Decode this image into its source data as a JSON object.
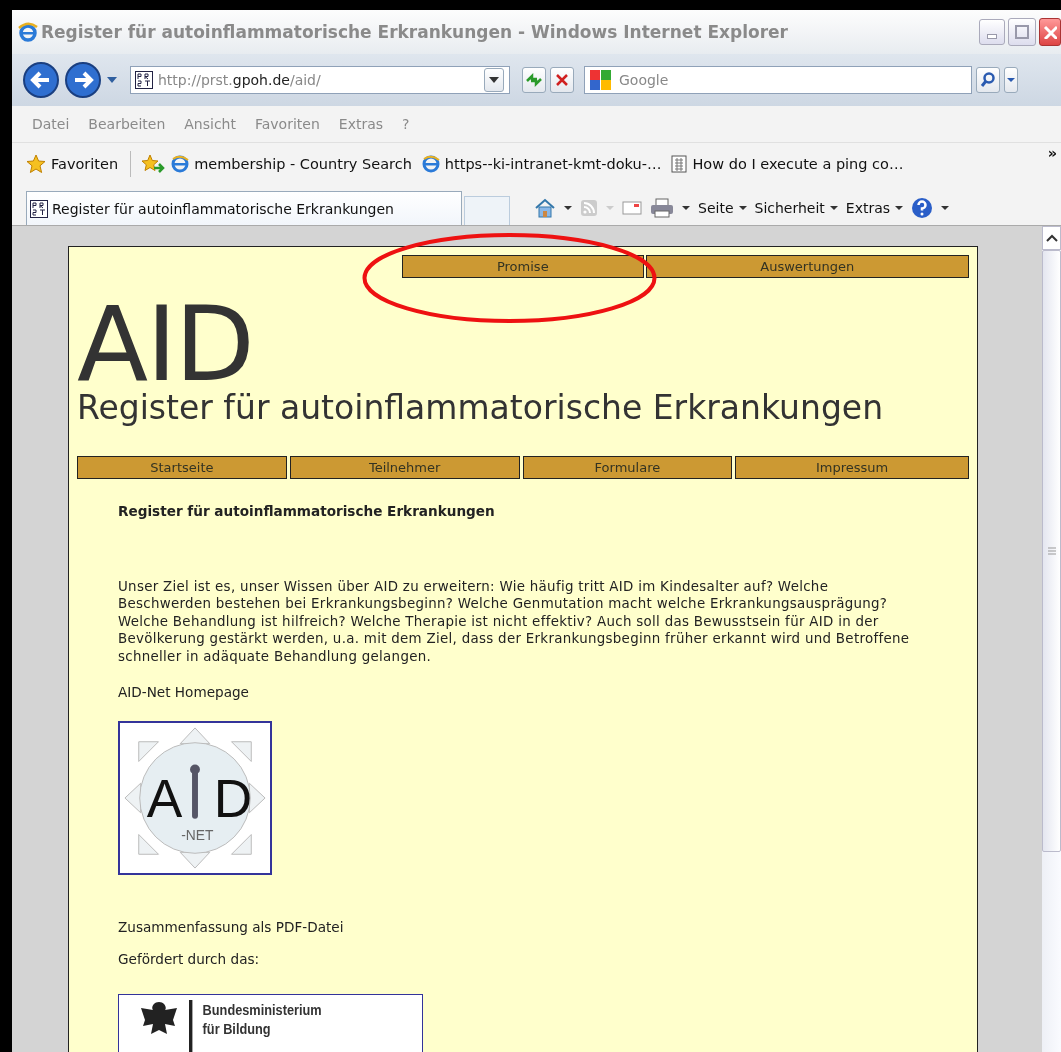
{
  "window": {
    "title": "Register für autoinflammatorische Erkrankungen - Windows Internet Explorer"
  },
  "address_bar": {
    "url_prefix": "http://prst.",
    "url_host": "gpoh.de",
    "url_suffix": "/aid/"
  },
  "search": {
    "placeholder": "Google"
  },
  "menu": [
    "Datei",
    "Bearbeiten",
    "Ansicht",
    "Favoriten",
    "Extras",
    "?"
  ],
  "favorites_bar": {
    "label": "Favoriten",
    "links": [
      {
        "label": "membership - Country Search",
        "kind": "ie"
      },
      {
        "label": "https--ki-intranet-kmt-doku-…",
        "kind": "ie"
      },
      {
        "label": "How do I execute a ping co…",
        "kind": "doc"
      }
    ],
    "more": "»"
  },
  "tabs": [
    {
      "label": "Register für autoinflammatorische Erkrankungen",
      "selected": true
    }
  ],
  "command_bar": [
    "Seite",
    "Sicherheit",
    "Extras"
  ],
  "page": {
    "top_nav": [
      "Promise",
      "Auswertungen"
    ],
    "logo": "AID",
    "subtitle": "Register für autoinflammatorische Erkrankungen",
    "main_nav": [
      "Startseite",
      "Teilnehmer",
      "Formulare",
      "Impressum"
    ],
    "heading": "Register für autoinflammatorische Erkrankungen",
    "intro": "Unser Ziel ist es, unser Wissen über AID zu erweitern: Wie häufig tritt AID im Kindesalter auf? Welche Beschwerden bestehen bei Erkrankungsbeginn? Welche Genmutation macht welche Erkrankungsausprägung? Welche Behandlung ist hilfreich? Welche Therapie ist nicht effektiv? Auch soll das Bewusstsein für AID in der Bevölkerung gestärkt werden, u.a. mit dem Ziel, dass der Erkrankungsbeginn früher erkannt wird und Betroffene schneller in adäquate Behandlung gelangen.",
    "homepage_link": "AID-Net Homepage",
    "aidnet_logo": {
      "left": "A",
      "right": "D",
      "sub": "-NET"
    },
    "pdf_link": "Zusammenfassung als PDF-Datei",
    "funding_label": "Gefördert durch das:",
    "ministry_logo": {
      "line_1": "Bundesministerium",
      "line_2": "für Bildung"
    }
  },
  "annotation": {
    "kind": "ellipse"
  }
}
